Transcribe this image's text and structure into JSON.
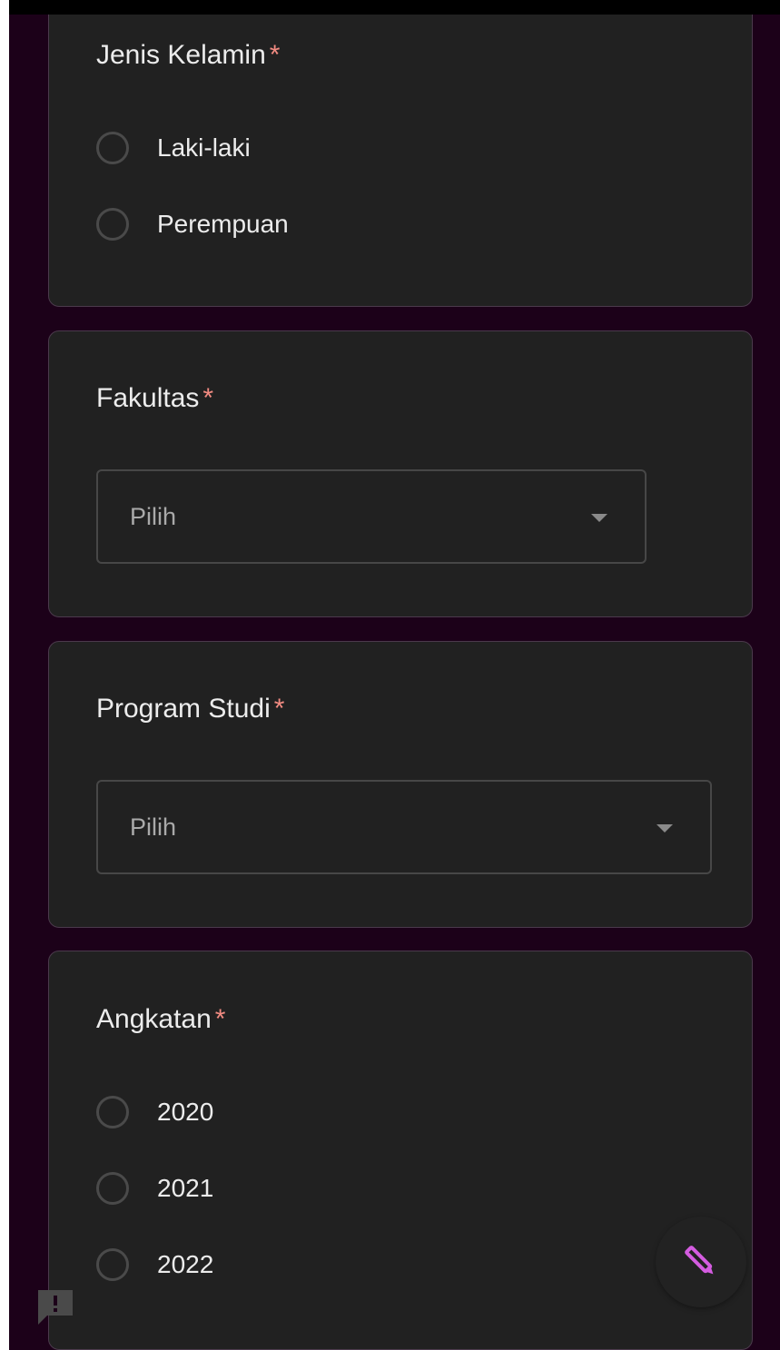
{
  "colors": {
    "background": "#1c0119",
    "card": "#212121",
    "card_border": "#4b3a4c",
    "text": "#ececec",
    "required": "#f28b82",
    "placeholder": "#a9a9a9",
    "accent_pencil": "#d45ce0"
  },
  "required_mark": "*",
  "questions": {
    "gender": {
      "title": "Jenis Kelamin",
      "options": [
        "Laki-laki",
        "Perempuan"
      ]
    },
    "faculty": {
      "title": "Fakultas",
      "select_value": "Pilih"
    },
    "study_program": {
      "title": "Program Studi",
      "select_value": "Pilih"
    },
    "year": {
      "title": "Angkatan",
      "options": [
        "2020",
        "2021",
        "2022"
      ]
    }
  },
  "icons": {
    "feedback": "feedback-icon",
    "edit": "pencil-icon",
    "dropdown": "caret-down-icon"
  }
}
